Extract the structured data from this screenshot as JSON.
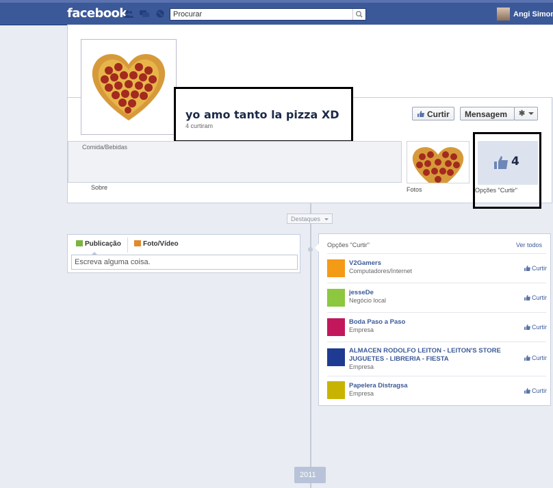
{
  "topbar": {
    "logo": "facebook",
    "search_placeholder": "Procurar",
    "user_name": "Angi Simon"
  },
  "page": {
    "name": "yo amo tanto la pizza XD",
    "likes_count": "4 curtiram",
    "category": "Comida/Bebidas",
    "about_label": "Sobre",
    "photos_label": "Fotos",
    "likes_number": "4",
    "likes_label": "Opções \"Curtir\""
  },
  "actions": {
    "like_label": "Curtir",
    "message_label": "Mensagem"
  },
  "timeline": {
    "highlights_label": "Destaques",
    "year_label": "2011"
  },
  "composer": {
    "post_tab": "Publicação",
    "photo_tab": "Foto/Vídeo",
    "input_placeholder": "Escreva alguma coisa."
  },
  "likes_panel": {
    "title": "Opções \"Curtir\"",
    "see_all": "Ver todos",
    "like_label": "Curtir",
    "items": [
      {
        "name": "V2Gamers",
        "type": "Computadores/Internet",
        "color": "#f39a16"
      },
      {
        "name": "jesseDe",
        "type": "Negócio local",
        "color": "#8dc63f"
      },
      {
        "name": "Boda Paso a Paso",
        "type": "Empresa",
        "color": "#c2185b"
      },
      {
        "name": "ALMACEN RODOLFO LEITON - LEITON'S STORE JUGUETES - LIBRERIA - FIESTA",
        "type": "Empresa",
        "color": "#1f3a93"
      },
      {
        "name": "Papelera Distragsa",
        "type": "Empresa",
        "color": "#c8b400"
      }
    ]
  },
  "colors": {
    "brand": "#3b5998",
    "link": "#3b5998",
    "background": "#e9ecf2"
  }
}
